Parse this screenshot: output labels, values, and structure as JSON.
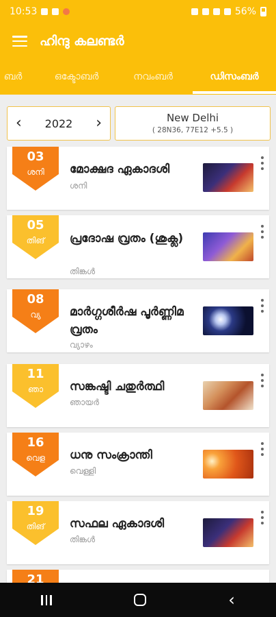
{
  "statusbar": {
    "time": "10:53",
    "battery": "56%"
  },
  "appbar": {
    "title": "ഹിന്ദു കലണ്ടർ"
  },
  "tabs": [
    {
      "label": "ബർ"
    },
    {
      "label": "ഒക്ടോബർ"
    },
    {
      "label": "നവംബർ"
    },
    {
      "label": "ഡിസംബർ"
    }
  ],
  "active_tab": "ഡിസംബർ",
  "year": {
    "value": "2022"
  },
  "location": {
    "name": "New Delhi",
    "coords": "( 28N36, 77E12 +5.5 )"
  },
  "colors": {
    "primary": "#fbbf0a",
    "orange": "#f57f17",
    "yellow": "#fbc02d"
  },
  "events": [
    {
      "day": "03",
      "weekday": "ശനി",
      "title": "മോക്ഷദ ഏകാദശി",
      "subtitle": "ശനി",
      "color": "#f57f17",
      "thumb": "krishna-arjuna-chariot"
    },
    {
      "day": "05",
      "weekday": "തിങ്",
      "title": "പ്രദോഷ വ്രതം (ശുക്ല)",
      "subtitle": "തിങ്കൾ",
      "color": "#fbc02d",
      "thumb": "shiva-deity"
    },
    {
      "day": "08",
      "weekday": "വ്യ",
      "title": "മാർഗ്ഗശീർഷ പൂർണ്ണിമ വ്രതം",
      "subtitle": "വ്യാഴം",
      "color": "#f57f17",
      "thumb": "full-moon-night"
    },
    {
      "day": "11",
      "weekday": "ഞാ",
      "title": "സങ്കഷ്ടി ചതുർത്ഥി",
      "subtitle": "ഞായർ",
      "color": "#fbc02d",
      "thumb": "ganesha"
    },
    {
      "day": "16",
      "weekday": "വെള",
      "title": "ധനു സംക്രാന്തി",
      "subtitle": "വെള്ളി",
      "color": "#f57f17",
      "thumb": "sunset-worship"
    },
    {
      "day": "19",
      "weekday": "തിങ്",
      "title": "സഫല ഏകാദശി",
      "subtitle": "തിങ്കൾ",
      "color": "#fbc02d",
      "thumb": "krishna-arjuna-chariot"
    },
    {
      "day": "21",
      "weekday": "",
      "title": "",
      "subtitle": "",
      "color": "#f57f17",
      "thumb": ""
    }
  ]
}
